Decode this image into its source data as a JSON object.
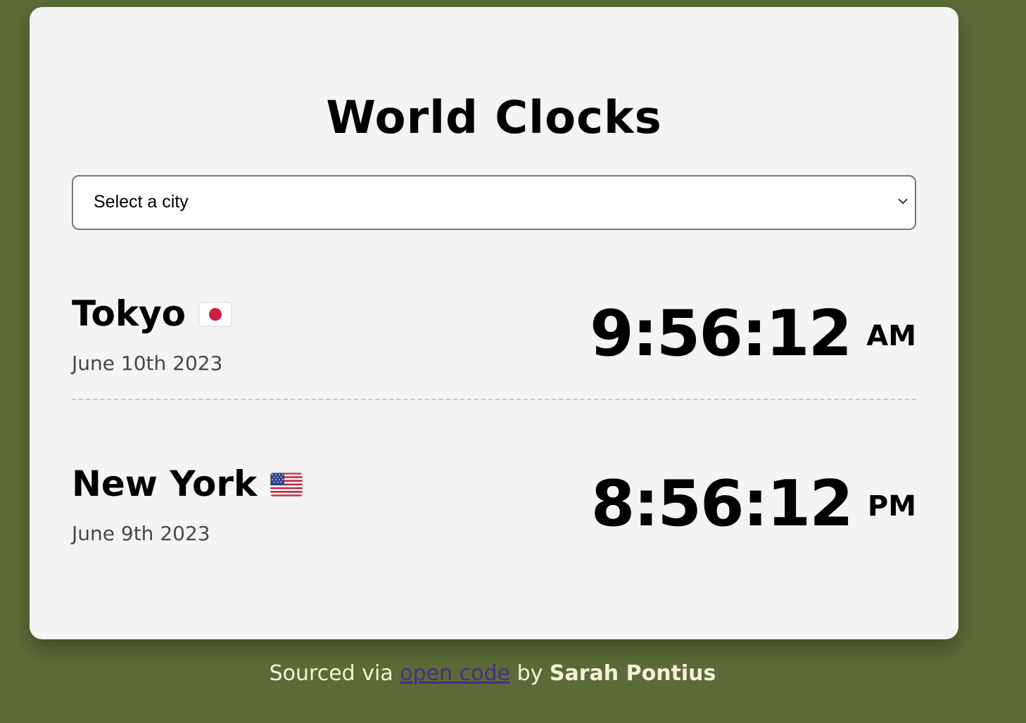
{
  "header": {
    "title": "World Clocks"
  },
  "city_select": {
    "selected": "Select a city"
  },
  "clocks": [
    {
      "city": "Tokyo",
      "flag": "japan-flag-icon",
      "date": "June 10th 2023",
      "time": "9:56:12",
      "period": "AM"
    },
    {
      "city": "New York",
      "flag": "us-flag-icon",
      "date": "June 9th 2023",
      "time": "8:56:12",
      "period": "PM"
    }
  ],
  "footer": {
    "prefix": "Sourced via",
    "link_text": "open code",
    "by": "by",
    "author": "Sarah Pontius"
  },
  "colors": {
    "background": "#5c6b37",
    "card": "#f4f4f4",
    "footer_text": "#f7f1d8",
    "link": "#4b2b86"
  }
}
